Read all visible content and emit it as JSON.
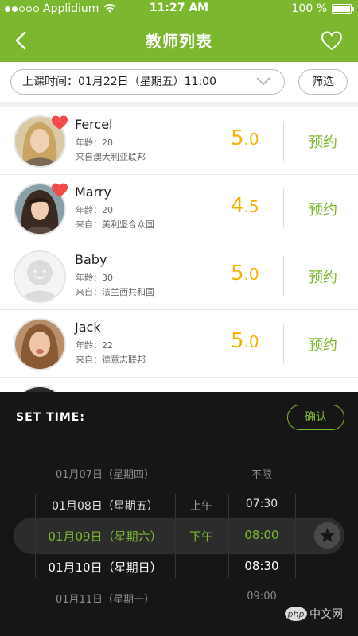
{
  "status": {
    "carrier": "Applidium",
    "time": "11:27 AM",
    "battery": "100 %"
  },
  "nav": {
    "title": "教师列表"
  },
  "time_filter": {
    "label": "上课时间：",
    "value": "01月22日（星期五）11:00",
    "filter_label": "筛选"
  },
  "teachers": [
    {
      "name": "Fercel",
      "age_label": "年龄：",
      "age": "28",
      "from_label": "来自",
      "from": "澳大利亚联邦",
      "score_int": "5",
      "score_dec": ".0",
      "book_label": "预约",
      "favorited": true
    },
    {
      "name": "Marry",
      "age_label": "年龄：",
      "age": "20",
      "from_label": "来自：",
      "from": "美利坚合众国",
      "score_int": "4",
      "score_dec": ".5",
      "book_label": "预约",
      "favorited": true
    },
    {
      "name": "Baby",
      "age_label": "年龄：",
      "age": "30",
      "from_label": "来自：",
      "from": "法兰西共和国",
      "score_int": "5",
      "score_dec": ".0",
      "book_label": "预约",
      "favorited": false
    },
    {
      "name": "Jack",
      "age_label": "年龄：",
      "age": "22",
      "from_label": "来自：",
      "from": "德意志联邦",
      "score_int": "5",
      "score_dec": ".0",
      "book_label": "预约",
      "favorited": false
    }
  ],
  "picker": {
    "set_label": "SET  TIME:",
    "confirm_label": "确认",
    "dates": [
      "01月07日（星期四）",
      "01月08日（星期五）",
      "01月09日（星期六）",
      "01月10日（星期日）",
      "01月11日（星期一）"
    ],
    "ampm": [
      "上午",
      "下午"
    ],
    "times": [
      "不限",
      "07:30",
      "08:00",
      "08:30",
      "09:00"
    ],
    "selected_index": 2,
    "watermark": "php 中文网"
  },
  "colors": {
    "accent": "#7cb82f",
    "score": "#f5b400",
    "picker_bg": "#161616"
  }
}
